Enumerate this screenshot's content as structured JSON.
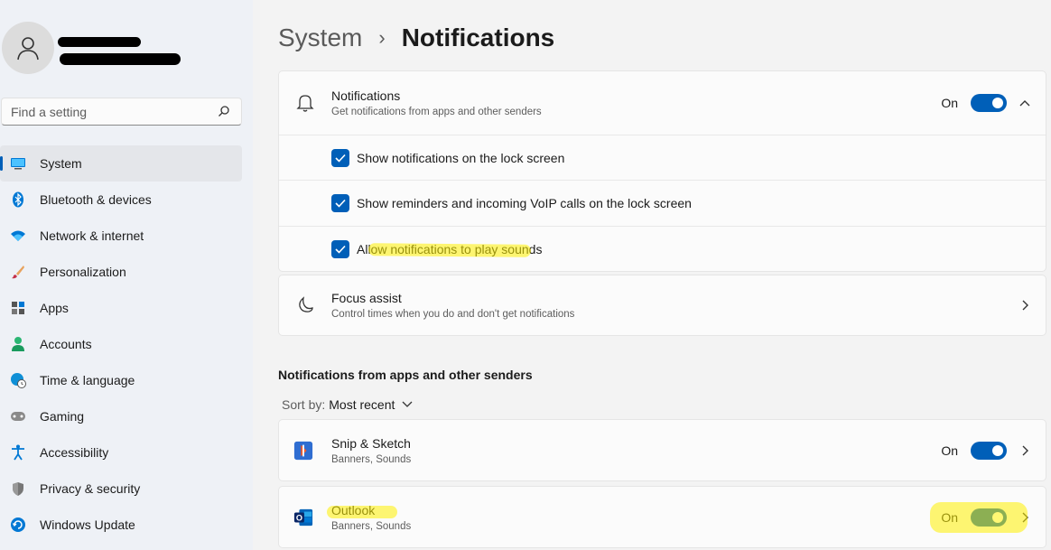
{
  "user": {
    "avatar_icon": "person-icon"
  },
  "search": {
    "placeholder": "Find a setting",
    "icon": "search-icon"
  },
  "sidebar": {
    "items": [
      {
        "label": "System",
        "icon": "monitor-icon",
        "active": true
      },
      {
        "label": "Bluetooth & devices",
        "icon": "bluetooth-icon"
      },
      {
        "label": "Network & internet",
        "icon": "wifi-icon"
      },
      {
        "label": "Personalization",
        "icon": "brush-icon"
      },
      {
        "label": "Apps",
        "icon": "apps-icon"
      },
      {
        "label": "Accounts",
        "icon": "account-icon"
      },
      {
        "label": "Time & language",
        "icon": "globe-clock-icon"
      },
      {
        "label": "Gaming",
        "icon": "gamepad-icon"
      },
      {
        "label": "Accessibility",
        "icon": "accessibility-icon"
      },
      {
        "label": "Privacy & security",
        "icon": "shield-icon"
      },
      {
        "label": "Windows Update",
        "icon": "update-icon"
      }
    ]
  },
  "breadcrumb": {
    "parent": "System",
    "separator": "›",
    "current": "Notifications"
  },
  "notifications": {
    "title": "Notifications",
    "subtitle": "Get notifications from apps and other senders",
    "state": "On",
    "enabled": true,
    "options": [
      {
        "label": "Show notifications on the lock screen",
        "checked": true
      },
      {
        "label": "Show reminders and incoming VoIP calls on the lock screen",
        "checked": true
      },
      {
        "label": "Allow notifications to play sounds",
        "checked": true
      }
    ]
  },
  "focus_assist": {
    "title": "Focus assist",
    "subtitle": "Control times when you do and don't get notifications"
  },
  "apps_section": {
    "heading": "Notifications from apps and other senders",
    "sort_label": "Sort by:",
    "sort_value": "Most recent",
    "apps": [
      {
        "name": "Snip & Sketch",
        "detail": "Banners, Sounds",
        "state": "On",
        "enabled": true
      },
      {
        "name": "Outlook",
        "detail": "Banners, Sounds",
        "state": "On",
        "enabled": true
      }
    ]
  },
  "colors": {
    "accent": "#005fb8",
    "highlight": "#fff000"
  }
}
